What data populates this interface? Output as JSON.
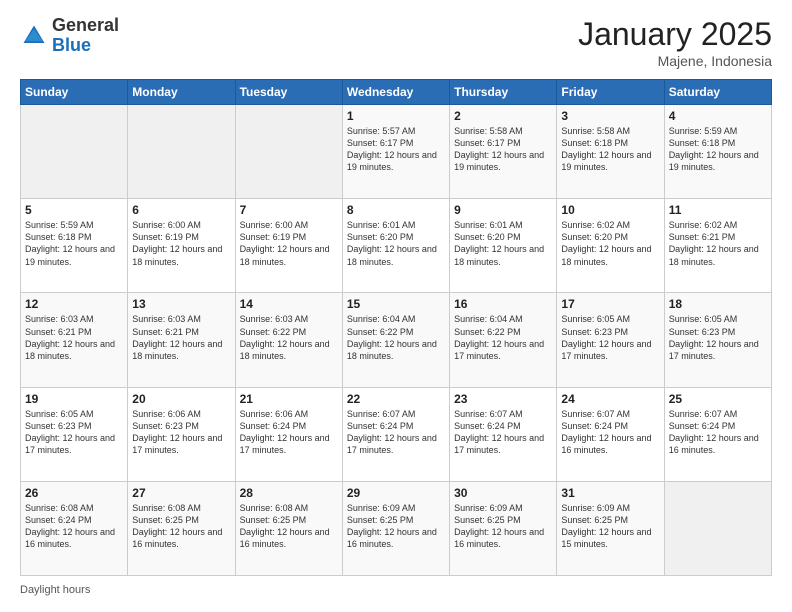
{
  "header": {
    "logo_general": "General",
    "logo_blue": "Blue",
    "month_title": "January 2025",
    "location": "Majene, Indonesia"
  },
  "footer": {
    "daylight_label": "Daylight hours"
  },
  "days_of_week": [
    "Sunday",
    "Monday",
    "Tuesday",
    "Wednesday",
    "Thursday",
    "Friday",
    "Saturday"
  ],
  "weeks": [
    [
      {
        "day": "",
        "info": ""
      },
      {
        "day": "",
        "info": ""
      },
      {
        "day": "",
        "info": ""
      },
      {
        "day": "1",
        "info": "Sunrise: 5:57 AM\nSunset: 6:17 PM\nDaylight: 12 hours and 19 minutes."
      },
      {
        "day": "2",
        "info": "Sunrise: 5:58 AM\nSunset: 6:17 PM\nDaylight: 12 hours and 19 minutes."
      },
      {
        "day": "3",
        "info": "Sunrise: 5:58 AM\nSunset: 6:18 PM\nDaylight: 12 hours and 19 minutes."
      },
      {
        "day": "4",
        "info": "Sunrise: 5:59 AM\nSunset: 6:18 PM\nDaylight: 12 hours and 19 minutes."
      }
    ],
    [
      {
        "day": "5",
        "info": "Sunrise: 5:59 AM\nSunset: 6:18 PM\nDaylight: 12 hours and 19 minutes."
      },
      {
        "day": "6",
        "info": "Sunrise: 6:00 AM\nSunset: 6:19 PM\nDaylight: 12 hours and 18 minutes."
      },
      {
        "day": "7",
        "info": "Sunrise: 6:00 AM\nSunset: 6:19 PM\nDaylight: 12 hours and 18 minutes."
      },
      {
        "day": "8",
        "info": "Sunrise: 6:01 AM\nSunset: 6:20 PM\nDaylight: 12 hours and 18 minutes."
      },
      {
        "day": "9",
        "info": "Sunrise: 6:01 AM\nSunset: 6:20 PM\nDaylight: 12 hours and 18 minutes."
      },
      {
        "day": "10",
        "info": "Sunrise: 6:02 AM\nSunset: 6:20 PM\nDaylight: 12 hours and 18 minutes."
      },
      {
        "day": "11",
        "info": "Sunrise: 6:02 AM\nSunset: 6:21 PM\nDaylight: 12 hours and 18 minutes."
      }
    ],
    [
      {
        "day": "12",
        "info": "Sunrise: 6:03 AM\nSunset: 6:21 PM\nDaylight: 12 hours and 18 minutes."
      },
      {
        "day": "13",
        "info": "Sunrise: 6:03 AM\nSunset: 6:21 PM\nDaylight: 12 hours and 18 minutes."
      },
      {
        "day": "14",
        "info": "Sunrise: 6:03 AM\nSunset: 6:22 PM\nDaylight: 12 hours and 18 minutes."
      },
      {
        "day": "15",
        "info": "Sunrise: 6:04 AM\nSunset: 6:22 PM\nDaylight: 12 hours and 18 minutes."
      },
      {
        "day": "16",
        "info": "Sunrise: 6:04 AM\nSunset: 6:22 PM\nDaylight: 12 hours and 17 minutes."
      },
      {
        "day": "17",
        "info": "Sunrise: 6:05 AM\nSunset: 6:23 PM\nDaylight: 12 hours and 17 minutes."
      },
      {
        "day": "18",
        "info": "Sunrise: 6:05 AM\nSunset: 6:23 PM\nDaylight: 12 hours and 17 minutes."
      }
    ],
    [
      {
        "day": "19",
        "info": "Sunrise: 6:05 AM\nSunset: 6:23 PM\nDaylight: 12 hours and 17 minutes."
      },
      {
        "day": "20",
        "info": "Sunrise: 6:06 AM\nSunset: 6:23 PM\nDaylight: 12 hours and 17 minutes."
      },
      {
        "day": "21",
        "info": "Sunrise: 6:06 AM\nSunset: 6:24 PM\nDaylight: 12 hours and 17 minutes."
      },
      {
        "day": "22",
        "info": "Sunrise: 6:07 AM\nSunset: 6:24 PM\nDaylight: 12 hours and 17 minutes."
      },
      {
        "day": "23",
        "info": "Sunrise: 6:07 AM\nSunset: 6:24 PM\nDaylight: 12 hours and 17 minutes."
      },
      {
        "day": "24",
        "info": "Sunrise: 6:07 AM\nSunset: 6:24 PM\nDaylight: 12 hours and 16 minutes."
      },
      {
        "day": "25",
        "info": "Sunrise: 6:07 AM\nSunset: 6:24 PM\nDaylight: 12 hours and 16 minutes."
      }
    ],
    [
      {
        "day": "26",
        "info": "Sunrise: 6:08 AM\nSunset: 6:24 PM\nDaylight: 12 hours and 16 minutes."
      },
      {
        "day": "27",
        "info": "Sunrise: 6:08 AM\nSunset: 6:25 PM\nDaylight: 12 hours and 16 minutes."
      },
      {
        "day": "28",
        "info": "Sunrise: 6:08 AM\nSunset: 6:25 PM\nDaylight: 12 hours and 16 minutes."
      },
      {
        "day": "29",
        "info": "Sunrise: 6:09 AM\nSunset: 6:25 PM\nDaylight: 12 hours and 16 minutes."
      },
      {
        "day": "30",
        "info": "Sunrise: 6:09 AM\nSunset: 6:25 PM\nDaylight: 12 hours and 16 minutes."
      },
      {
        "day": "31",
        "info": "Sunrise: 6:09 AM\nSunset: 6:25 PM\nDaylight: 12 hours and 15 minutes."
      },
      {
        "day": "",
        "info": ""
      }
    ]
  ]
}
